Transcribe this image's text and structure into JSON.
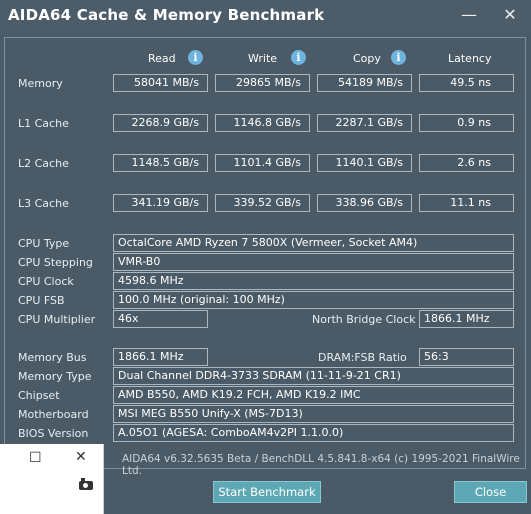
{
  "window": {
    "title": "AIDA64 Cache & Memory Benchmark",
    "minimize": "—",
    "close": "✕"
  },
  "columns": {
    "read": "Read",
    "write": "Write",
    "copy": "Copy",
    "latency": "Latency"
  },
  "rows": [
    {
      "label": "Memory",
      "read": "58041 MB/s",
      "write": "29865 MB/s",
      "copy": "54189 MB/s",
      "latency": "49.5 ns"
    },
    {
      "label": "L1 Cache",
      "read": "2268.9 GB/s",
      "write": "1146.8 GB/s",
      "copy": "2287.1 GB/s",
      "latency": "0.9 ns"
    },
    {
      "label": "L2 Cache",
      "read": "1148.5 GB/s",
      "write": "1101.4 GB/s",
      "copy": "1140.1 GB/s",
      "latency": "2.6 ns"
    },
    {
      "label": "L3 Cache",
      "read": "341.19 GB/s",
      "write": "339.52 GB/s",
      "copy": "338.96 GB/s",
      "latency": "11.1 ns"
    }
  ],
  "cpu": {
    "type_label": "CPU Type",
    "type": "OctalCore AMD Ryzen 7 5800X  (Vermeer, Socket AM4)",
    "stepping_label": "CPU Stepping",
    "stepping": "VMR-B0",
    "clock_label": "CPU Clock",
    "clock": "4598.6 MHz",
    "fsb_label": "CPU FSB",
    "fsb": "100.0 MHz  (original: 100 MHz)",
    "multiplier_label": "CPU Multiplier",
    "multiplier": "46x",
    "nb_clock_label": "North Bridge Clock",
    "nb_clock": "1866.1 MHz"
  },
  "memory": {
    "bus_label": "Memory Bus",
    "bus": "1866.1 MHz",
    "ratio_label": "DRAM:FSB Ratio",
    "ratio": "56:3",
    "type_label": "Memory Type",
    "type": "Dual Channel DDR4-3733 SDRAM  (11-11-9-21 CR1)",
    "chipset_label": "Chipset",
    "chipset": "AMD B550, AMD K19.2 FCH, AMD K19.2 IMC",
    "motherboard_label": "Motherboard",
    "motherboard": "MSI MEG B550 Unify-X (MS-7D13)",
    "bios_label": "BIOS Version",
    "bios": "A.05O1  (AGESA: ComboAM4v2PI 1.1.0.0)"
  },
  "footer": "AIDA64 v6.32.5635 Beta / BenchDLL 4.5.841.8-x64  (c) 1995-2021 FinalWire Ltd.",
  "buttons": {
    "start": "Start Benchmark",
    "close": "Close"
  },
  "popup": {
    "maximize": "☐",
    "close": "✕"
  },
  "colors": {
    "background": "#4a5a66",
    "button": "#5ea8b6",
    "info_icon": "#6fb3df"
  }
}
